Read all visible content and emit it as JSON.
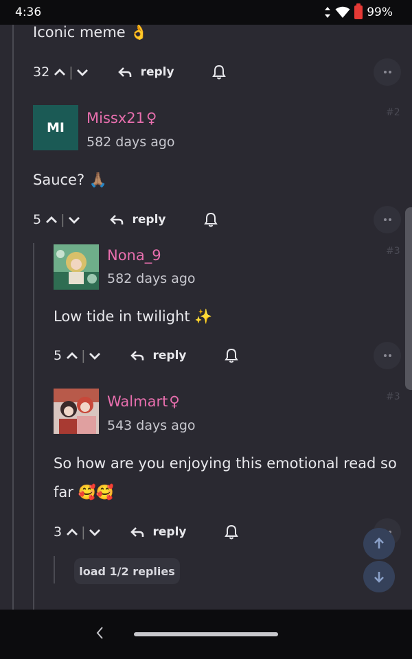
{
  "status_bar": {
    "time": "4:36",
    "battery": "99%"
  },
  "comments": [
    {
      "text": "Iconic meme 👌",
      "votes": "32",
      "reply_label": "reply"
    },
    {
      "avatar_initials": "MI",
      "username": "Missx21",
      "gender_symbol": "♀",
      "timestamp": "582 days ago",
      "post_num": "#2",
      "text": "Sauce? 🙏🏽",
      "votes": "5",
      "reply_label": "reply"
    },
    {
      "username": "Nona_9",
      "timestamp": "582 days ago",
      "post_num": "#3",
      "text": "Low tide in twilight ✨",
      "votes": "5",
      "reply_label": "reply"
    },
    {
      "username": "Walmart",
      "gender_symbol": "♀",
      "timestamp": "543 days ago",
      "post_num": "#3",
      "text_line1": "So how are you enjoying this emotional read so",
      "text_line2": "far 🥰🥰",
      "votes": "3",
      "reply_label": "reply"
    }
  ],
  "load_replies": "load 1/2 replies",
  "colors": {
    "background": "#2a2931",
    "username": "#e86fae",
    "avatar_bg": "#1b5a55",
    "fab_bg": "#35415a"
  }
}
